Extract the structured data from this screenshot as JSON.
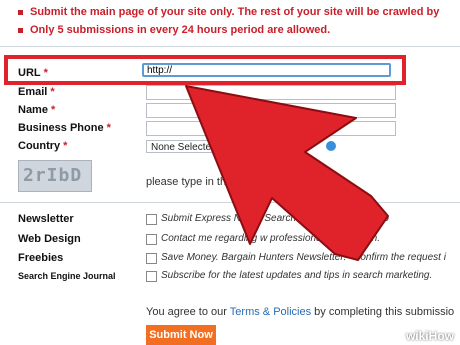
{
  "notes": [
    "Submit the main page of your site only. The rest of your site will be crawled by",
    "Only 5 submissions in every 24 hours period are allowed."
  ],
  "form": {
    "url_label": "URL",
    "url_value": "http://",
    "email_label": "Email",
    "name_label": "Name",
    "phone_label": "Business Phone",
    "country_label": "Country",
    "country_value": "None Selecte",
    "required_mark": "*",
    "captcha_text": "2rIbD",
    "captcha_hint": "please type in the                    in the image on the left",
    "options": [
      {
        "label": "Newsletter",
        "text": "Submit Express New...  Search              ys and promotion tip"
      },
      {
        "label": "Web Design",
        "text": "Contact me regarding        w professional web design."
      },
      {
        "label": "Freebies",
        "text": "Save Money. Bargain Hunters Newsletter! *Confirm the request i"
      },
      {
        "label": "Search Engine Journal",
        "text": "Subscribe for the latest updates and tips in search marketing."
      }
    ],
    "agree_prefix": "You agree to our ",
    "agree_link": "Terms & Policies",
    "agree_suffix": " by completing this submissio",
    "submit_label": "Submit Now"
  },
  "watermark": {
    "wiki": "wiki",
    "how": "How"
  },
  "colors": {
    "accent_red": "#e0232a",
    "submit_orange": "#f26f21",
    "link_blue": "#2a6db2"
  }
}
